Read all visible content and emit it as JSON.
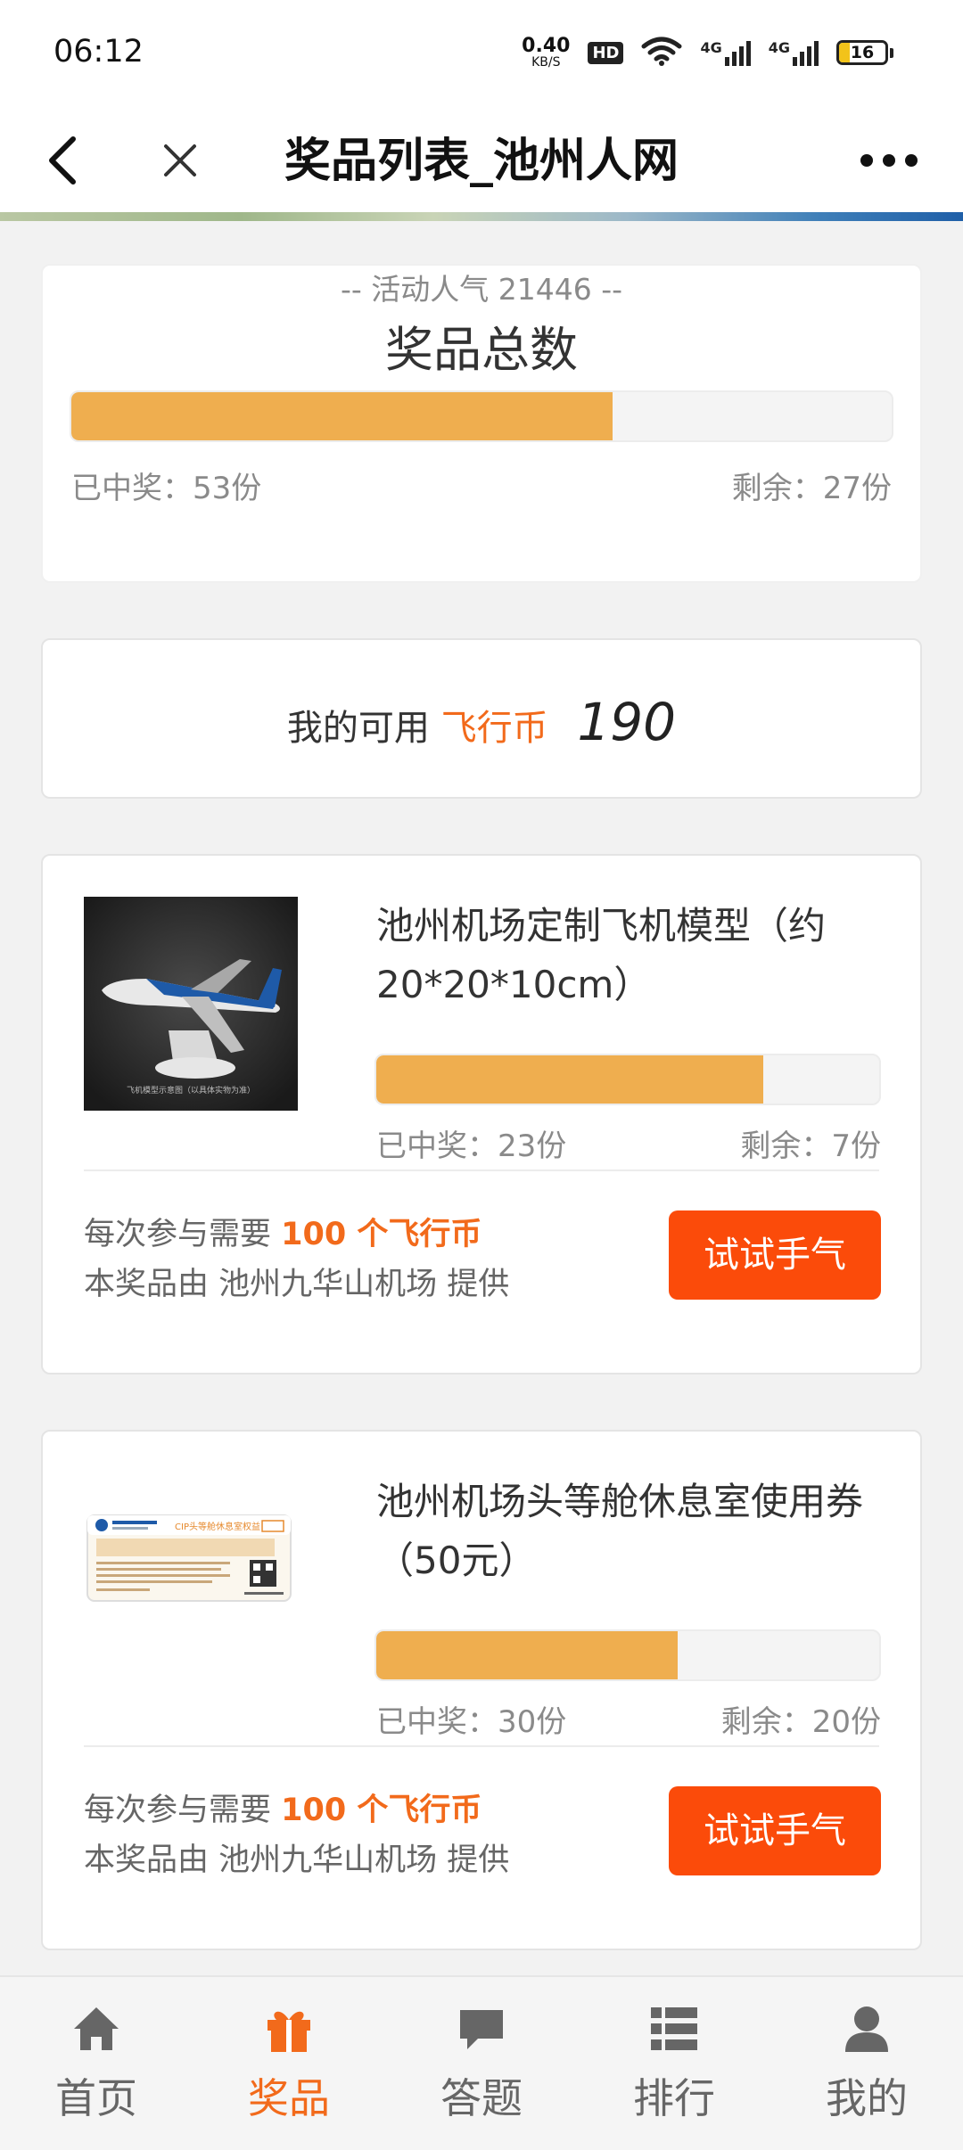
{
  "status": {
    "time": "06:12",
    "net_speed_value": "0.40",
    "net_speed_unit": "KB/S",
    "hd": "HD",
    "signal1_label": "4G",
    "signal2_label": "4G",
    "battery": "16"
  },
  "nav": {
    "title": "奖品列表_池州人网"
  },
  "summary": {
    "title": "奖品总数",
    "progress": 0.66,
    "won_label": "已中奖：53份",
    "remaining_label": "剩余：27份",
    "popularity": "-- 活动人气  21446 --"
  },
  "coins": {
    "prefix": "我的可用",
    "coin_name": "飞行币",
    "value": "190"
  },
  "prizes": [
    {
      "name": "池州机场定制飞机模型（约20*20*10cm）",
      "image_caption": "飞机模型示意图（以具体实物为准）",
      "progress": 0.77,
      "won_label": "已中奖：23份",
      "remaining_label": "剩余：7份",
      "cost_prefix": "每次参与需要",
      "cost_value": "100 个飞行币",
      "provider": "本奖品由 池州九华山机场 提供",
      "button": "试试手气"
    },
    {
      "name": "池州机场头等舱休息室使用券（50元）",
      "image_caption": "CIP头等舱休息室权益",
      "progress": 0.6,
      "won_label": "已中奖：30份",
      "remaining_label": "剩余：20份",
      "cost_prefix": "每次参与需要",
      "cost_value": "100 个飞行币",
      "provider": "本奖品由 池州九华山机场 提供",
      "button": "试试手气"
    }
  ],
  "tabs": [
    {
      "label": "首页",
      "icon": "home-icon",
      "active": false
    },
    {
      "label": "奖品",
      "icon": "gift-icon",
      "active": true
    },
    {
      "label": "答题",
      "icon": "chat-icon",
      "active": false
    },
    {
      "label": "排行",
      "icon": "list-icon",
      "active": false
    },
    {
      "label": "我的",
      "icon": "user-icon",
      "active": false
    }
  ],
  "colors": {
    "accent": "#f26a1b",
    "button": "#fb4b0a",
    "progress_fill": "#efae4f"
  }
}
